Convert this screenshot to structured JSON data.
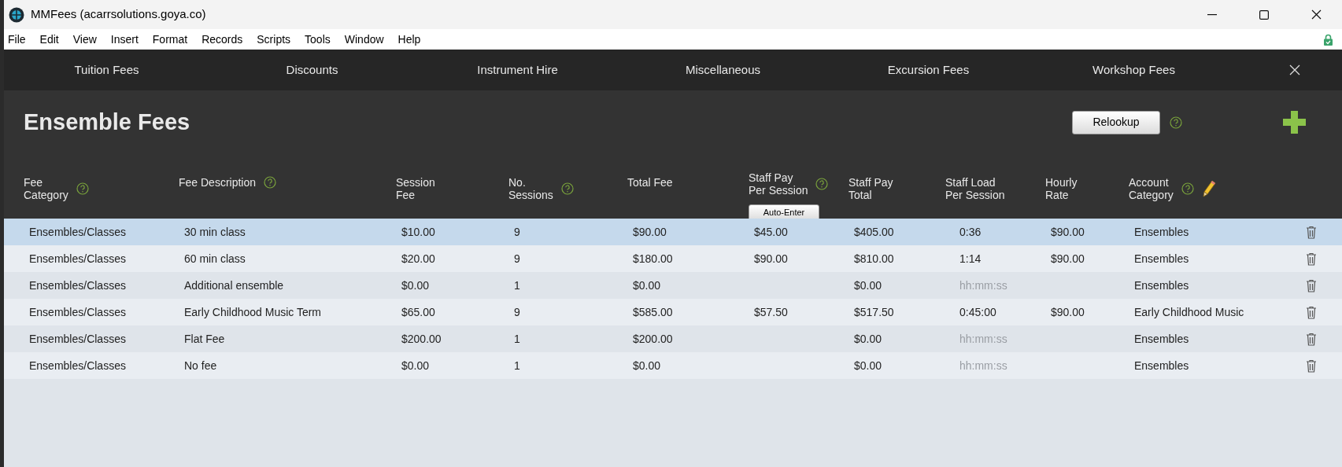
{
  "window": {
    "title": "MMFees (acarrsolutions.goya.co)"
  },
  "menu": [
    "File",
    "Edit",
    "View",
    "Insert",
    "Format",
    "Records",
    "Scripts",
    "Tools",
    "Window",
    "Help"
  ],
  "nav_tabs": [
    "Tuition Fees",
    "Discounts",
    "Instrument Hire",
    "Miscellaneous",
    "Excursion Fees",
    "Workshop Fees"
  ],
  "page": {
    "title": "Ensemble Fees",
    "relookup_button": "Relookup",
    "auto_enter_button": "Auto-Enter"
  },
  "columns": [
    {
      "label": "Fee\nCategory",
      "icons": [
        {
          "kind": "help"
        }
      ]
    },
    {
      "label": "Fee Description",
      "icons": [
        {
          "kind": "help"
        }
      ]
    },
    {
      "label": "Session\nFee"
    },
    {
      "label": "No.\nSessions",
      "icons": [
        {
          "kind": "help"
        }
      ]
    },
    {
      "label": "Total Fee"
    },
    {
      "label": "Staff Pay\nPer Session",
      "icons": [
        {
          "kind": "help"
        }
      ]
    },
    {
      "label": "Staff Pay\nTotal"
    },
    {
      "label": "Staff Load\nPer Session"
    },
    {
      "label": "Hourly\nRate"
    },
    {
      "label": "Account\nCategory",
      "icons": [
        {
          "kind": "help"
        },
        {
          "kind": "edit"
        }
      ]
    }
  ],
  "rows": [
    {
      "selected": true,
      "cells": [
        "Ensembles/Classes",
        "30 min class",
        "$10.00",
        "9",
        "$90.00",
        "$45.00",
        "$405.00",
        {
          "value": "0:36"
        },
        "$90.00",
        "Ensembles"
      ]
    },
    {
      "selected": false,
      "cells": [
        "Ensembles/Classes",
        "60 min class",
        "$20.00",
        "9",
        "$180.00",
        "$90.00",
        "$810.00",
        {
          "value": "1:14"
        },
        "$90.00",
        "Ensembles"
      ]
    },
    {
      "selected": false,
      "cells": [
        "Ensembles/Classes",
        "Additional ensemble",
        "$0.00",
        "1",
        "$0.00",
        "",
        "$0.00",
        {
          "placeholder": "hh:mm:ss"
        },
        "",
        "Ensembles"
      ]
    },
    {
      "selected": false,
      "cells": [
        "Ensembles/Classes",
        "Early Childhood Music Term",
        "$65.00",
        "9",
        "$585.00",
        "$57.50",
        "$517.50",
        {
          "value": "0:45:00"
        },
        "$90.00",
        "Early Childhood Music"
      ]
    },
    {
      "selected": false,
      "cells": [
        "Ensembles/Classes",
        "Flat Fee",
        "$200.00",
        "1",
        "$200.00",
        "",
        "$0.00",
        {
          "placeholder": "hh:mm:ss"
        },
        "",
        "Ensembles"
      ]
    },
    {
      "selected": false,
      "cells": [
        "Ensembles/Classes",
        "No fee",
        "$0.00",
        "1",
        "$0.00",
        "",
        "$0.00",
        {
          "placeholder": "hh:mm:ss"
        },
        "",
        "Ensembles"
      ]
    }
  ]
}
